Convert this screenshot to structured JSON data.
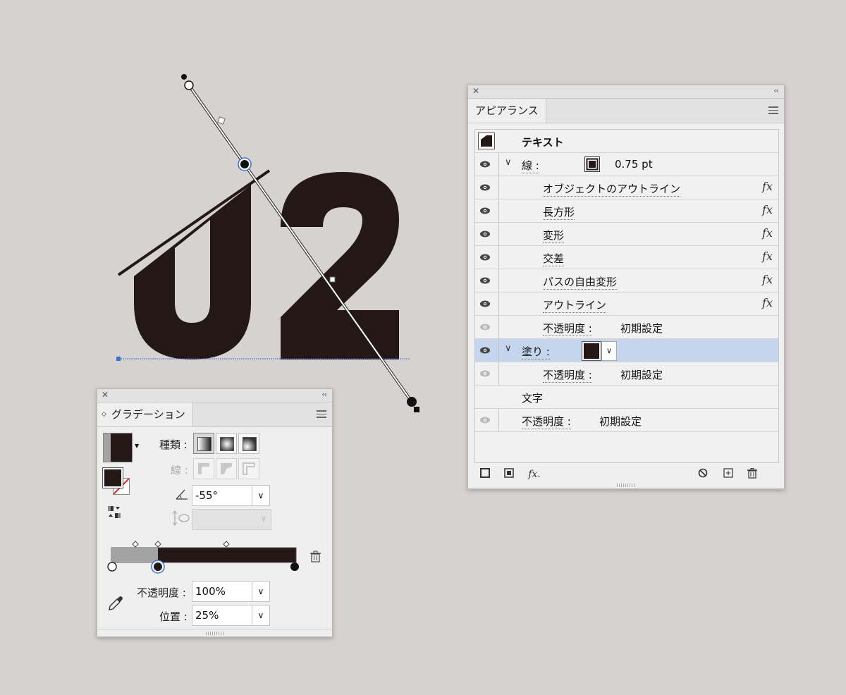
{
  "artwork": {
    "text": "02",
    "fill_color": "#231815",
    "baseline_color": "#3b6fd8"
  },
  "appearance_panel": {
    "tab": "アピアランス",
    "rows": [
      {
        "label": "テキスト"
      },
      {
        "label": "線 :",
        "value": "0.75 pt"
      },
      {
        "label": "オブジェクトのアウトライン",
        "fx": "fx"
      },
      {
        "label": "長方形",
        "fx": "fx"
      },
      {
        "label": "変形",
        "fx": "fx"
      },
      {
        "label": "交差",
        "fx": "fx"
      },
      {
        "label": "パスの自由変形",
        "fx": "fx"
      },
      {
        "label": "アウトライン",
        "fx": "fx"
      },
      {
        "label": "不透明度 :",
        "value": "初期設定"
      },
      {
        "label": "塗り :"
      },
      {
        "label": "不透明度 :",
        "value": "初期設定"
      },
      {
        "label": "文字"
      },
      {
        "label": "不透明度 :",
        "value": "初期設定"
      }
    ],
    "footer_fx": "fx."
  },
  "gradient_panel": {
    "tab": "グラデーション",
    "type_label": "種類 :",
    "stroke_label": "線 :",
    "angle": "-55°",
    "opacity_label": "不透明度 :",
    "opacity_value": "100%",
    "location_label": "位置 :",
    "location_value": "25%"
  },
  "colors": {
    "selected_row": "#c5d5ee",
    "accent": "#3b6fd8",
    "stop_gray": "#a3a3a3",
    "stop_dark": "#231815"
  }
}
